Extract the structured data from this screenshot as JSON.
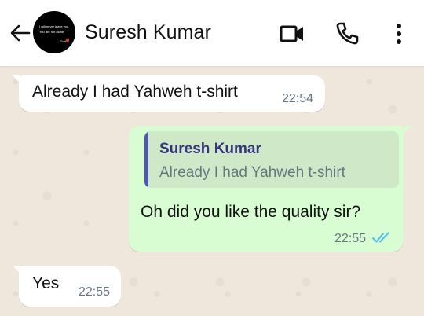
{
  "header": {
    "contact_name": "Suresh Kumar",
    "avatar_text_line1": "I will never leave you.",
    "avatar_text_line2": "You are not alone.",
    "avatar_text_line3": "- God"
  },
  "colors": {
    "header_bg": "#ffffff",
    "chat_bg": "#efe7dc",
    "incoming_bubble": "#ffffff",
    "outgoing_bubble": "#d9fdd3",
    "read_ticks": "#53bdeb",
    "quote_bar": "#5157ae"
  },
  "icons": {
    "back": "arrow-left-icon",
    "video": "video-call-icon",
    "call": "phone-icon",
    "menu": "more-vert-icon",
    "status": "double-check-icon"
  },
  "messages": [
    {
      "direction": "incoming",
      "text": "Already I had Yahweh t-shirt",
      "time": "22:54"
    },
    {
      "direction": "outgoing",
      "quote_name": "Suresh Kumar",
      "quote_text": "Already I had Yahweh t-shirt",
      "text": "Oh did you like the quality sir?",
      "time": "22:55",
      "status": "read"
    },
    {
      "direction": "incoming",
      "text": "Yes",
      "time": "22:55"
    }
  ]
}
